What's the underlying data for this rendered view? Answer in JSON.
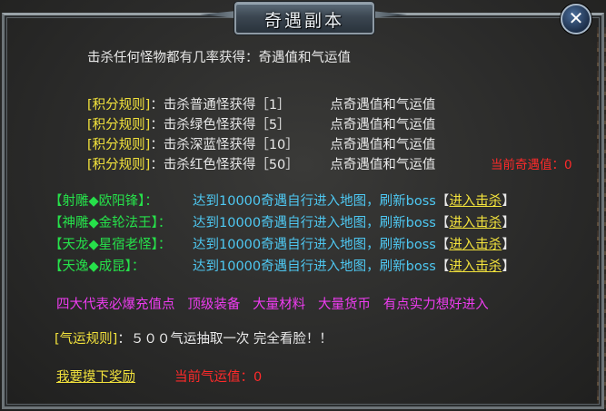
{
  "window": {
    "title": "奇遇副本",
    "close_icon": "close-icon"
  },
  "intro": "击杀任何怪物都有几率获得：奇遇值和气运值",
  "rules": [
    {
      "tag": "[积分规则]",
      "text": "：击杀普通怪获得［1］",
      "reward": "点奇遇值和气运值"
    },
    {
      "tag": "[积分规则]",
      "text": "：击杀绿色怪获得［5］",
      "reward": "点奇遇值和气运值"
    },
    {
      "tag": "[积分规则]",
      "text": "：击杀深蓝怪获得［10］",
      "reward": "点奇遇值和气运值"
    },
    {
      "tag": "[积分规则]",
      "text": "：击杀红色怪获得［50］",
      "reward": "点奇遇值和气运值"
    }
  ],
  "current_qiyu": "当前奇遇值：0",
  "bosses": [
    {
      "name": "【射雕◆欧阳锋】：",
      "desc": "达到10000奇遇自行进入地图，刷新boss",
      "action": "进入击杀",
      "open": "【",
      "close": "】"
    },
    {
      "name": "【神雕◆金轮法王】：",
      "desc": "达到10000奇遇自行进入地图，刷新boss",
      "action": "进入击杀",
      "open": "【",
      "close": "】"
    },
    {
      "name": "【天龙◆星宿老怪】：",
      "desc": "达到10000奇遇自行进入地图，刷新boss",
      "action": "进入击杀",
      "open": "【",
      "close": "】"
    },
    {
      "name": "【天逸◆成昆】：",
      "desc": "达到10000奇遇自行进入地图，刷新boss",
      "action": "进入击杀",
      "open": "【",
      "close": "】"
    }
  ],
  "promo": "四大代表必爆充值点   顶级装备   大量材料   大量货币   有点实力想好进入",
  "qiyun_rule": {
    "tag": "[气运规则]",
    "text": "：５００气运抽取一次 完全看脸！！"
  },
  "claim_label": "我要摸下奖励",
  "current_qiyun": "当前气运值：0",
  "colors": {
    "yellow": "#f2e23c",
    "green": "#26e04a",
    "cyan": "#4ec8f2",
    "red": "#ff2a2a",
    "magenta": "#ee3cf0"
  }
}
